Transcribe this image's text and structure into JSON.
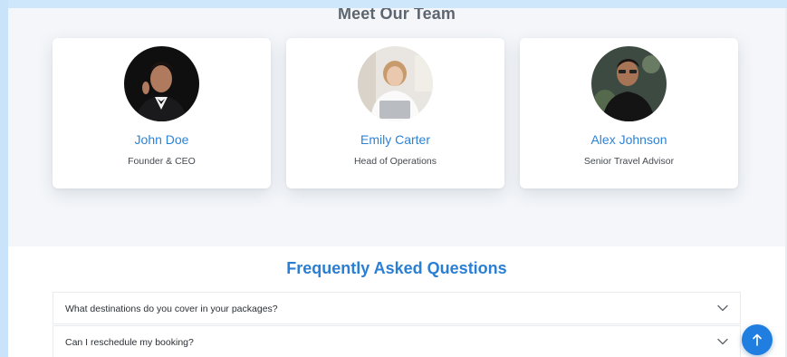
{
  "team": {
    "title": "Meet Our Team",
    "members": [
      {
        "name": "John Doe",
        "role": "Founder & CEO"
      },
      {
        "name": "Emily Carter",
        "role": "Head of Operations"
      },
      {
        "name": "Alex Johnson",
        "role": "Senior Travel Advisor"
      }
    ]
  },
  "faq": {
    "title": "Frequently Asked Questions",
    "items": [
      {
        "question": "What destinations do you cover in your packages?",
        "icon": "chevron-down-icon"
      },
      {
        "question": "Can I reschedule my booking?",
        "icon": "chevron-down-icon"
      }
    ]
  },
  "scroll_to_top": {
    "icon": "arrow-up-icon"
  },
  "colors": {
    "accent": "#2c83d6",
    "button": "#1f7ee0",
    "section_bg": "#f4f6f9",
    "frame_bg": "#cde6fb"
  }
}
